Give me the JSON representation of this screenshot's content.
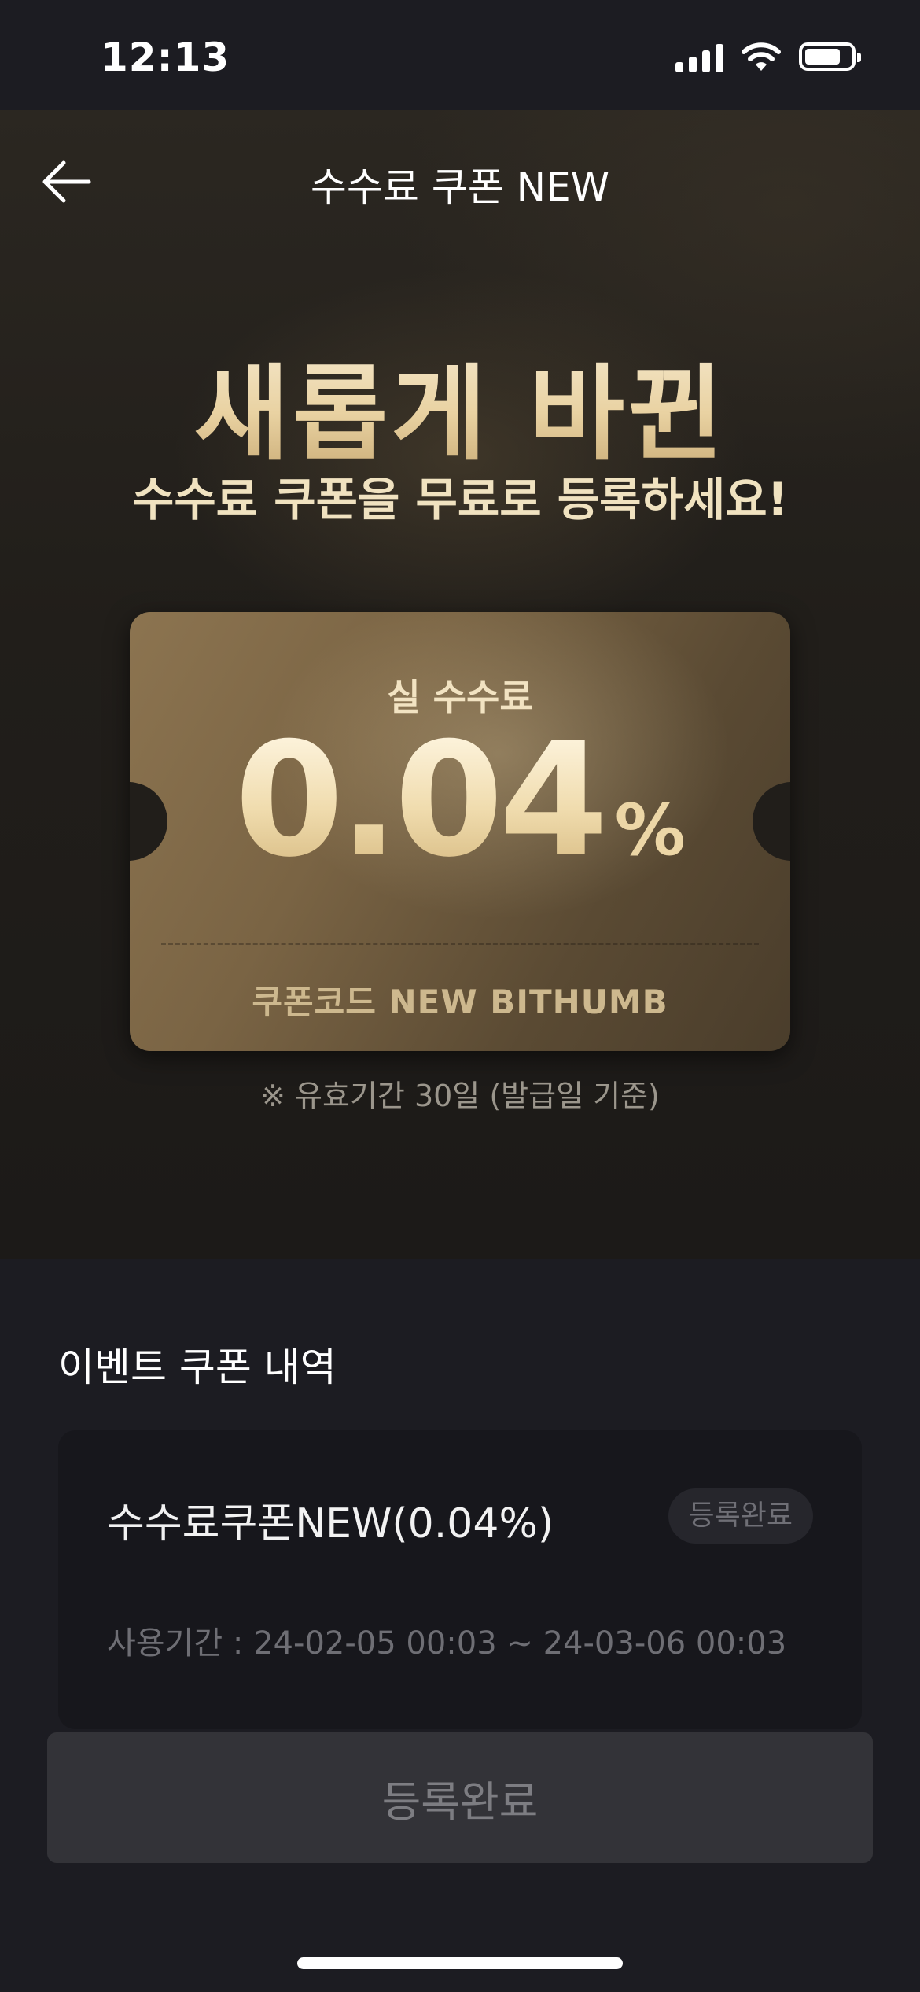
{
  "status": {
    "time": "12:13"
  },
  "nav": {
    "title": "수수료 쿠폰 NEW"
  },
  "hero": {
    "headline": "새롭게 바뀐",
    "subtitle": "수수료 쿠폰을 무료로 등록하세요!"
  },
  "ticket": {
    "label": "실 수수료",
    "rate": "0.04",
    "unit": "%",
    "code": "쿠폰코드  NEW BITHUMB"
  },
  "validity": "※ 유효기간 30일 (발급일 기준)",
  "history": {
    "title": "이벤트 쿠폰 내역",
    "items": [
      {
        "name": "수수료쿠폰NEW(0.04%)",
        "status": "등록완료",
        "period": "사용기간 : 24-02-05 00:03 ~ 24-03-06 00:03"
      }
    ]
  },
  "action": {
    "label": "등록완료"
  },
  "colors": {
    "accent_gold": "#e9d2a2",
    "background": "#1c1c22",
    "card": "#17171c"
  }
}
